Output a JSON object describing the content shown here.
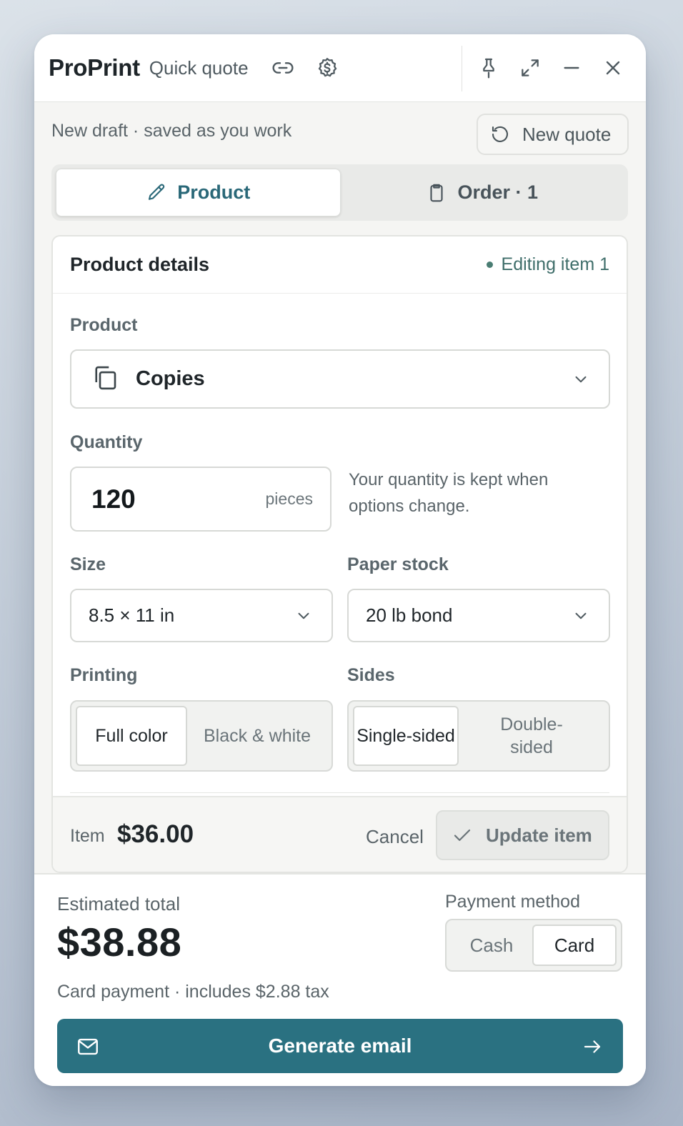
{
  "window": {
    "brand": "ProPrint",
    "subtitle": "Quick quote",
    "toolbar_icons": [
      "link-icon",
      "dollar-icon",
      "pin-icon",
      "expand-icon",
      "minimize-icon",
      "close-icon"
    ]
  },
  "draft": {
    "status": "New draft · saved as you work",
    "new_quote_label": "New quote"
  },
  "tabs": [
    {
      "label": "Product",
      "icon": "pencil-icon",
      "active": true
    },
    {
      "label": "Order · 1",
      "icon": "clipboard-icon",
      "active": false
    }
  ],
  "card": {
    "title": "Product details",
    "editing_status": "Editing item 1",
    "product": {
      "label": "Product",
      "value": "Copies",
      "icon": "copies-icon"
    },
    "quantity": {
      "label": "Quantity",
      "value": "120",
      "unit": "pieces",
      "help": "Your quantity is kept when options change."
    },
    "size": {
      "label": "Size",
      "value": "8.5 × 11 in"
    },
    "paper": {
      "label": "Paper stock",
      "value": "20 lb bond"
    },
    "printing": {
      "label": "Printing",
      "options": [
        "Full color",
        "Black & white"
      ],
      "selected": "Full color"
    },
    "sides": {
      "label": "Sides",
      "options": [
        "Single-sided",
        "Double-sided"
      ],
      "selected": "Single-sided"
    },
    "footer": {
      "item_label": "Item",
      "item_price": "$36.00",
      "cancel_label": "Cancel",
      "update_label": "Update item"
    }
  },
  "summary": {
    "estimated_label": "Estimated total",
    "estimated_total": "$38.88",
    "note": "Card payment · includes $2.88 tax",
    "payment_label": "Payment method",
    "payment_options": [
      "Cash",
      "Card"
    ],
    "payment_selected": "Card",
    "generate_label": "Generate email"
  },
  "colors": {
    "accent": "#2a7181",
    "tab_active_text": "#2a6878",
    "editing_dot": "#4a7d73"
  }
}
